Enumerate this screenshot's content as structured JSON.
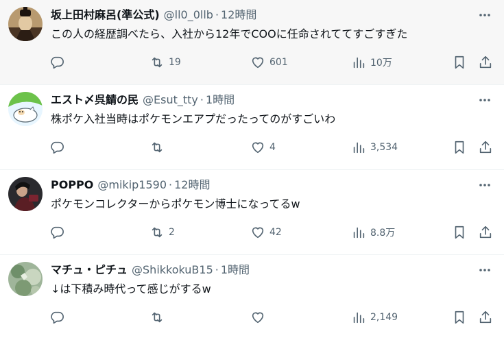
{
  "posts": [
    {
      "name": "坂上田村麻呂(準公式)",
      "handle": "@ll0_0llb",
      "separator": "·",
      "time": "12時間",
      "text": "この人の経歴調べたら、入社から12年でCOOに任命されててすごすぎた",
      "replies": "",
      "reposts": "19",
      "likes": "601",
      "views": "10万",
      "highlighted": true
    },
    {
      "name": "エスト〆呉鯖の民",
      "handle": "@Esut_tty",
      "separator": "·",
      "time": "1時間",
      "text": "株ポケ入社当時はポケモンエアプだったってのがすごいわ",
      "replies": "",
      "reposts": "",
      "likes": "4",
      "views": "3,534",
      "highlighted": false
    },
    {
      "name": "POPPO",
      "handle": "@mikip1590",
      "separator": "·",
      "time": "12時間",
      "text": "ポケモンコレクターからポケモン博士になってるw",
      "replies": "",
      "reposts": "2",
      "likes": "42",
      "views": "8.8万",
      "highlighted": false
    },
    {
      "name": "マチュ・ピチュ",
      "handle": "@ShikkokuB15",
      "separator": "·",
      "time": "1時間",
      "text": "↓は下積み時代って感じがするw",
      "replies": "",
      "reposts": "",
      "likes": "",
      "views": "2,149",
      "highlighted": false
    }
  ],
  "icons": {
    "more": "more-dots-icon",
    "reply": "reply-icon",
    "repost": "repost-icon",
    "like": "heart-icon",
    "views": "views-chart-icon",
    "bookmark": "bookmark-icon",
    "share": "share-icon"
  },
  "colors": {
    "text": "#0f1419",
    "muted": "#536471",
    "highlight_bg": "#f7f7f7",
    "divider": "#eff3f4"
  }
}
